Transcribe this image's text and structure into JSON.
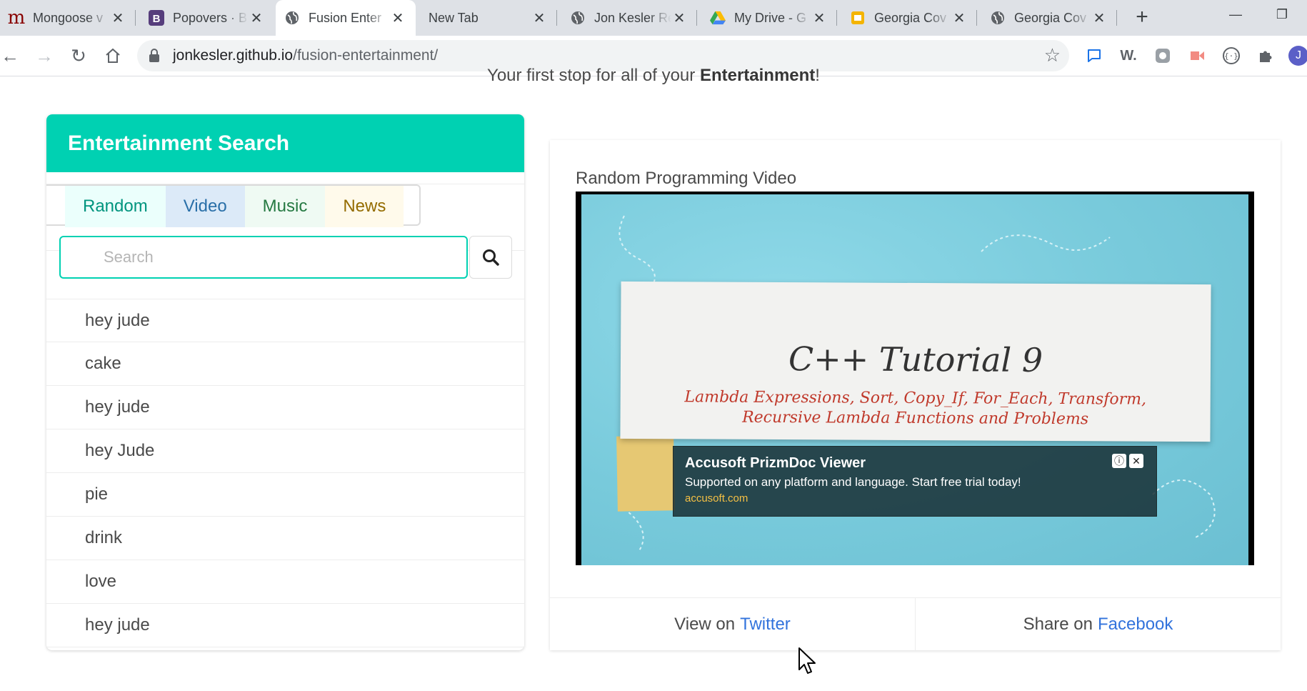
{
  "browser": {
    "tabs": [
      {
        "title": "Mongoose v",
        "icon": "mongoose-m-icon",
        "active": false
      },
      {
        "title": "Popovers · B",
        "icon": "bootstrap-icon",
        "active": false
      },
      {
        "title": "Fusion Enter",
        "icon": "globe-icon",
        "active": true
      },
      {
        "title": "New Tab",
        "icon": "",
        "active": false
      },
      {
        "title": "Jon Kesler Re",
        "icon": "globe-icon",
        "active": false
      },
      {
        "title": "My Drive - G",
        "icon": "google-drive-icon",
        "active": false
      },
      {
        "title": "Georgia Cov",
        "icon": "google-slides-icon",
        "active": false
      },
      {
        "title": "Georgia Cov",
        "icon": "globe-icon",
        "active": false
      }
    ],
    "url_host": "jonkesler.github.io",
    "url_path": "/fusion-entertainment/",
    "profile_initial": "J"
  },
  "page": {
    "tagline_prefix": "Your first stop for all of your ",
    "tagline_bold": "Entertainment",
    "tagline_suffix": "!"
  },
  "search_panel": {
    "heading": "Entertainment Search",
    "filters": [
      "Random",
      "Video",
      "Music",
      "News"
    ],
    "search_placeholder": "Search",
    "search_value": "",
    "results": [
      "hey jude",
      "cake",
      "hey jude",
      "hey Jude",
      "pie",
      "drink",
      "love",
      "hey jude"
    ]
  },
  "video_card": {
    "title": "Random Programming Video",
    "video_heading": "C++ Tutorial 9",
    "video_sub_line1": "Lambda Expressions, Sort, Copy_If, For_Each, Transform,",
    "video_sub_line2": "Recursive Lambda Functions and Problems",
    "ad": {
      "title": "Accusoft PrizmDoc Viewer",
      "description": "Supported on any platform and language. Start free trial today!",
      "url": "accusoft.com"
    },
    "footer": [
      {
        "prefix": "View on",
        "link": "Twitter"
      },
      {
        "prefix": "Share on",
        "link": "Facebook"
      }
    ]
  },
  "colors": {
    "primary": "#00d1b2",
    "link": "#3273dc",
    "random_tab": "#ebfffc",
    "video_tab": "#dceaf8",
    "music_tab": "#effaf3",
    "news_tab": "#fffaeb"
  }
}
